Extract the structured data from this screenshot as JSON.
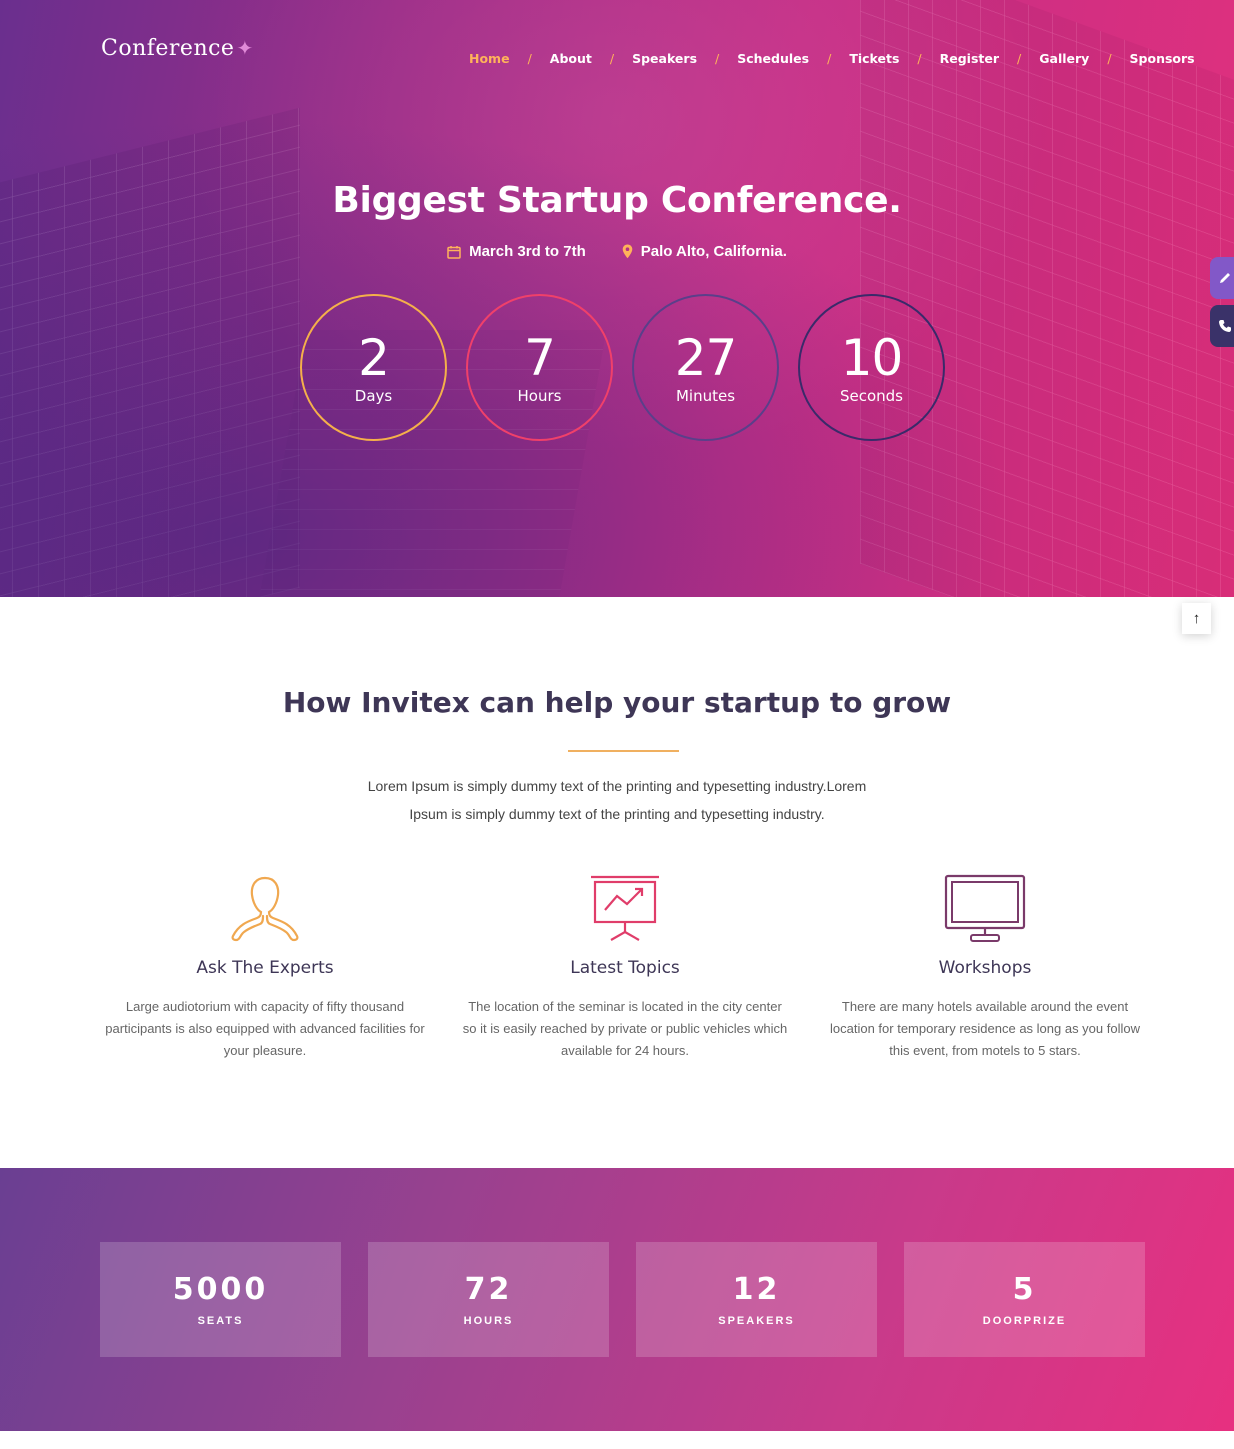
{
  "brand": {
    "logo_text": "Conference",
    "logo_star": "✦"
  },
  "nav": {
    "items": [
      "Home",
      "About",
      "Speakers",
      "Schedules",
      "Tickets",
      "Register",
      "Gallery",
      "Sponsors"
    ],
    "active": "Home",
    "separator": "/"
  },
  "hero": {
    "title": "Biggest Startup Conference.",
    "date": "March 3rd to 7th",
    "location": "Palo Alto, California.",
    "date_icon": "calendar-icon",
    "location_icon": "map-pin-icon"
  },
  "countdown": [
    {
      "value": "2",
      "label": "Days",
      "color": "#f5b04a"
    },
    {
      "value": "7",
      "label": "Hours",
      "color": "#f0406a"
    },
    {
      "value": "27",
      "label": "Minutes",
      "color": "#5a3f8a"
    },
    {
      "value": "10",
      "label": "Seconds",
      "color": "#3a2a6a"
    }
  ],
  "side_tools": {
    "edit_icon": "pencil-icon",
    "phone_icon": "phone-icon"
  },
  "scroll_top": {
    "icon": "arrow-up-icon",
    "glyph": "↑"
  },
  "section": {
    "title": "How Invitex can help your startup to grow",
    "desc_line1": "Lorem Ipsum is simply dummy text of the printing and typesetting industry.Lorem",
    "desc_line2": "Ipsum is simply dummy text of the printing and typesetting industry.",
    "accent_color": "#f0b060"
  },
  "features": [
    {
      "title": "Ask The Experts",
      "icon": "user-icon",
      "color": "#f0a850",
      "text": "Large audiotorium with capacity of fifty thousand participants is also equipped with advanced facilities for your pleasure."
    },
    {
      "title": "Latest Topics",
      "icon": "presentation-chart-icon",
      "color": "#e03d6a",
      "text": "The location of the seminar is located in the city center so it is easily reached by private or public vehicles which available for 24 hours."
    },
    {
      "title": "Workshops",
      "icon": "monitor-icon",
      "color": "#7a3a6a",
      "text": "There are many hotels available around the event location for temporary residence as long as you follow this event, from motels to 5 stars."
    }
  ],
  "stats": [
    {
      "value": "5000",
      "label": "SEATS"
    },
    {
      "value": "72",
      "label": "HOURS"
    },
    {
      "value": "12",
      "label": "SPEAKERS"
    },
    {
      "value": "5",
      "label": "DOORPRIZE"
    }
  ]
}
